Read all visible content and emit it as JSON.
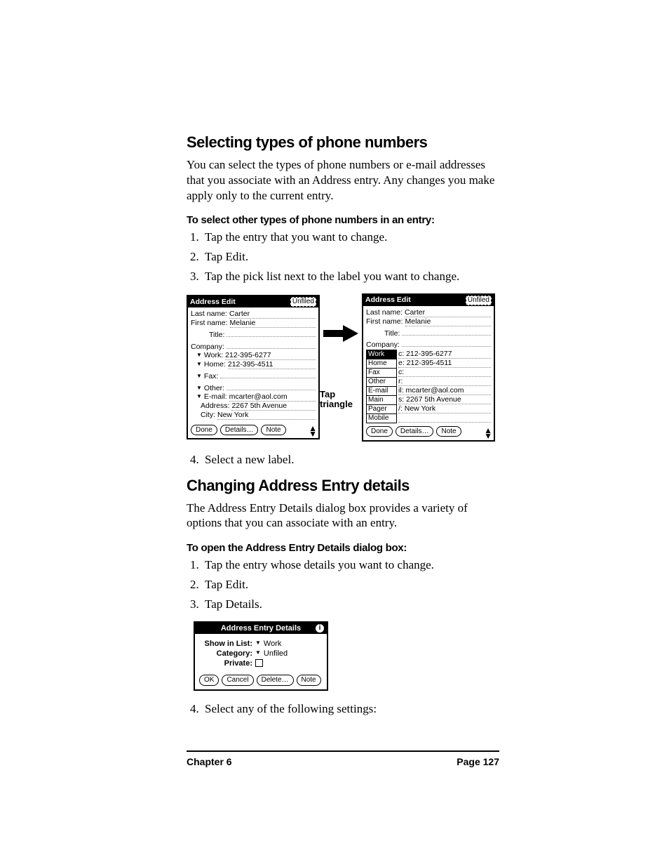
{
  "section1": {
    "heading": "Selecting types of phone numbers",
    "para": "You can select the types of phone numbers or e-mail addresses that you associate with an Address entry. Any changes you make apply only to the current entry.",
    "subhead": "To select other types of phone numbers in an entry:",
    "steps": [
      "Tap the entry that you want to change.",
      "Tap Edit.",
      "Tap the pick list next to the label you want to change."
    ],
    "step4": "Select a new label."
  },
  "figA": {
    "title": "Address Edit",
    "category": "Unfiled",
    "lastname_label": "Last name:",
    "lastname_val": "Carter",
    "firstname_label": "First name:",
    "firstname_val": "Melanie",
    "title_label": "Title:",
    "title_val": "",
    "company_label": "Company:",
    "company_val": "",
    "rows": [
      {
        "lab": "Work:",
        "val": "212-395-6277",
        "tri": true
      },
      {
        "lab": "Home:",
        "val": "212-395-4511",
        "tri": true
      },
      {
        "lab": "Fax:",
        "val": "",
        "tri": true
      },
      {
        "lab": "Other:",
        "val": "",
        "tri": true
      },
      {
        "lab": "E-mail:",
        "val": "mcarter@aol.com",
        "tri": true
      },
      {
        "lab": "Address:",
        "val": "2267 5th Avenue",
        "tri": false
      },
      {
        "lab": "City:",
        "val": "New York",
        "tri": false
      }
    ],
    "buttons": [
      "Done",
      "Details…",
      "Note"
    ]
  },
  "figB": {
    "title": "Address Edit",
    "category": "Unfiled",
    "lastname_label": "Last name:",
    "lastname_val": "Carter",
    "firstname_label": "First name:",
    "firstname_val": "Melanie",
    "title_label": "Title:",
    "title_val": "",
    "company_label": "Company:",
    "company_val": "",
    "options": [
      "Work",
      "Home",
      "Fax",
      "Other",
      "E-mail",
      "Main",
      "Pager",
      "Mobile"
    ],
    "optvals": [
      "c: 212-395-6277",
      "e: 212-395-4511",
      "c:",
      "r:",
      "il: mcarter@aol.com",
      "s: 2267 5th Avenue",
      "/: New York",
      ""
    ],
    "selected_index": 0,
    "buttons": [
      "Done",
      "Details…",
      "Note"
    ]
  },
  "caption": {
    "line1": "Tap",
    "line2": "triangle"
  },
  "section2": {
    "heading": "Changing Address Entry details",
    "para": "The Address Entry Details dialog box provides a variety of options that you can associate with an entry.",
    "subhead": "To open the Address Entry Details dialog box:",
    "steps": [
      "Tap the entry whose details you want to change.",
      "Tap Edit.",
      "Tap Details."
    ],
    "step4": "Select any of the following settings:"
  },
  "dlg": {
    "title": "Address Entry Details",
    "rows": {
      "show_label": "Show in List:",
      "show_val": "Work",
      "cat_label": "Category:",
      "cat_val": "Unfiled",
      "priv_label": "Private:"
    },
    "buttons": [
      "OK",
      "Cancel",
      "Delete…",
      "Note"
    ]
  },
  "footer": {
    "chapter": "Chapter 6",
    "page": "Page 127"
  }
}
